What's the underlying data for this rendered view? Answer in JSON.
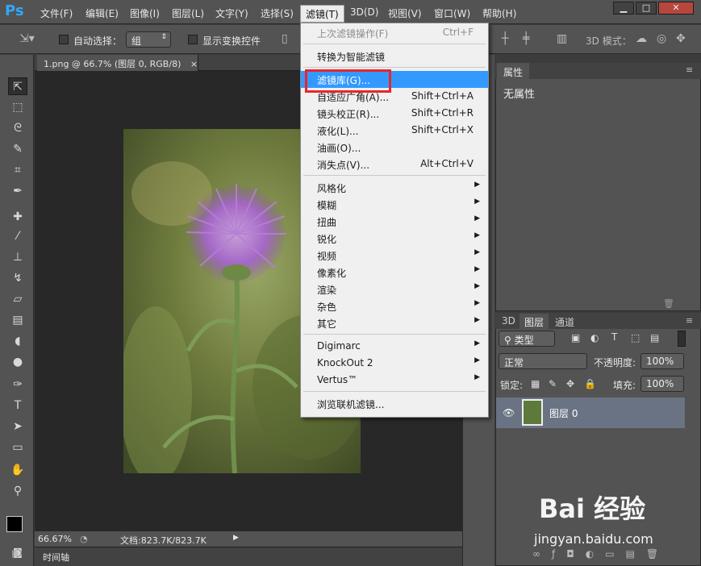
{
  "app": {
    "logo": "Ps"
  },
  "menubar": {
    "items": [
      "文件(F)",
      "编辑(E)",
      "图像(I)",
      "图层(L)",
      "文字(Y)",
      "选择(S)",
      "滤镜(T)",
      "3D(D)",
      "视图(V)",
      "窗口(W)",
      "帮助(H)"
    ],
    "active_index": 6
  },
  "window_buttons": {
    "minimize": "▁",
    "maximize": "□",
    "close": "✕"
  },
  "options_bar": {
    "auto_select_label": "自动选择：",
    "auto_select_value": "组",
    "show_transform_label": "显示变换控件",
    "mode_3d_label": "3D 模式："
  },
  "document": {
    "tab_title": "1.png @ 66.7% (图层 0, RGB/8)",
    "tab_close": "×",
    "zoom": "66.67%",
    "doc_info": "文档:823.7K/823.7K",
    "timeline_label": "时间轴"
  },
  "filter_menu": {
    "items": [
      {
        "label": "上次滤镜操作(F)",
        "shortcut": "Ctrl+F",
        "disabled": true
      },
      {
        "separator": true
      },
      {
        "label": "转换为智能滤镜"
      },
      {
        "separator": true
      },
      {
        "label": "滤镜库(G)...",
        "highlighted": true
      },
      {
        "label": "自适应广角(A)...",
        "shortcut": "Shift+Ctrl+A"
      },
      {
        "label": "镜头校正(R)...",
        "shortcut": "Shift+Ctrl+R"
      },
      {
        "label": "液化(L)...",
        "shortcut": "Shift+Ctrl+X"
      },
      {
        "label": "油画(O)..."
      },
      {
        "label": "消失点(V)...",
        "shortcut": "Alt+Ctrl+V"
      },
      {
        "separator": true
      },
      {
        "label": "风格化",
        "submenu": true
      },
      {
        "label": "模糊",
        "submenu": true
      },
      {
        "label": "扭曲",
        "submenu": true
      },
      {
        "label": "锐化",
        "submenu": true
      },
      {
        "label": "视频",
        "submenu": true
      },
      {
        "label": "像素化",
        "submenu": true
      },
      {
        "label": "渲染",
        "submenu": true
      },
      {
        "label": "杂色",
        "submenu": true
      },
      {
        "label": "其它",
        "submenu": true
      },
      {
        "separator": true
      },
      {
        "label": "Digimarc",
        "submenu": true
      },
      {
        "label": "KnockOut 2",
        "submenu": true
      },
      {
        "label": "Vertus™",
        "submenu": true
      },
      {
        "separator": true
      },
      {
        "label": "浏览联机滤镜..."
      }
    ],
    "arrow_glyph": "▶"
  },
  "properties_panel": {
    "tab": "属性",
    "empty_text": "无属性"
  },
  "layers_panel": {
    "tabs": [
      "3D",
      "图层",
      "通道"
    ],
    "active_tab": 1,
    "filter_type": "类型",
    "blend_mode": "正常",
    "opacity_label": "不透明度:",
    "opacity_value": "100%",
    "lock_label": "锁定:",
    "fill_label": "填充:",
    "fill_value": "100%",
    "layer_name": "图层 0"
  },
  "watermark": {
    "logo": "Bai 经验",
    "url": "jingyan.baidu.com"
  },
  "colors": {
    "accent_blue": "#3399ff",
    "highlight_red": "#e8252c",
    "ps_blue": "#31a8ff"
  }
}
